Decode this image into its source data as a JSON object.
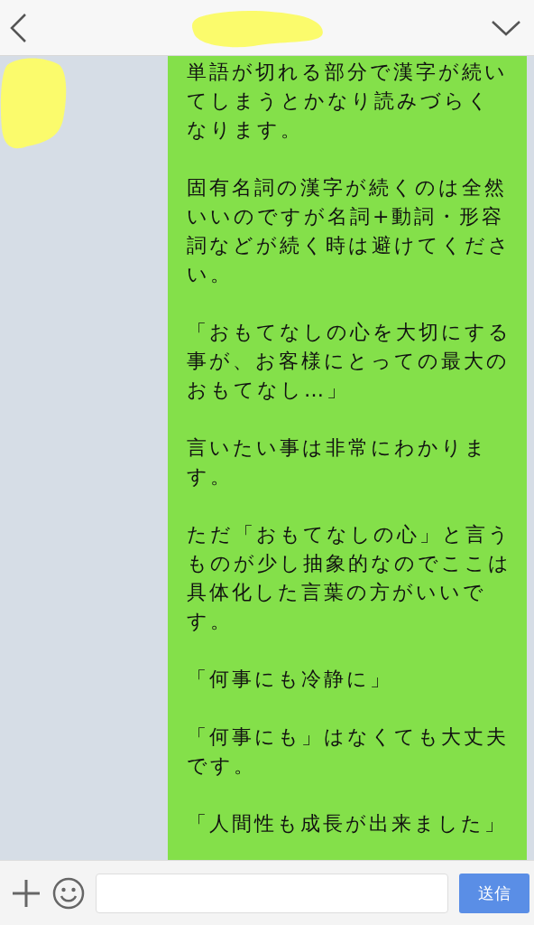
{
  "messages": [
    {
      "paragraphs": [
        "単語が切れる部分で漢字が続いてしまうとかなり読みづらくなります。",
        "固有名詞の漢字が続くのは全然いいのですが名詞+動詞・形容詞などが続く時は避けてください。",
        "「おもてなしの心を大切にする事が、お客様にとっての最大のおもてなし…」",
        "言いたい事は非常にわかります。",
        "ただ「おもてなしの心」と言うものが少し抽象的なのでここは具体化した言葉の方がいいです。",
        "「何事にも冷静に」",
        "「何事にも」はなくても大丈夫です。",
        "「人間性も成長が出来ました」"
      ]
    }
  ],
  "composer": {
    "send_label": "送信"
  }
}
